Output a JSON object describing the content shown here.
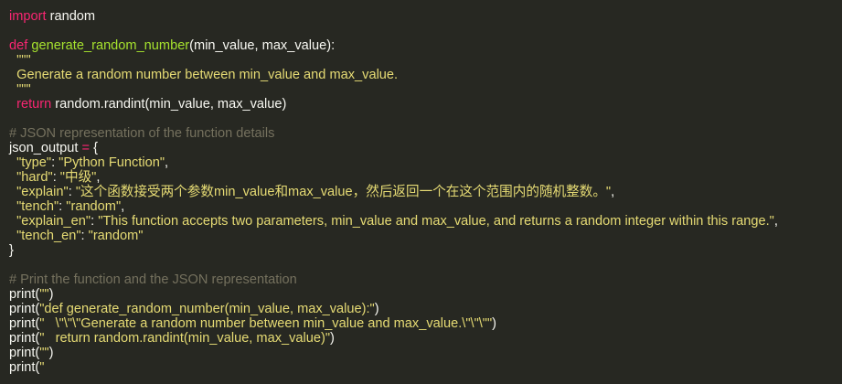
{
  "theme": {
    "background": "#272822",
    "plain": "#f8f8f2",
    "keyword": "#f92672",
    "function": "#a6e22e",
    "string": "#e6db74",
    "comment": "#75715e"
  },
  "code": {
    "l01": {
      "kw": "import",
      "rest": " random"
    },
    "l03": {
      "kw": "def",
      "sp": " ",
      "fn": "generate_random_number",
      "rest": "(min_value, max_value):"
    },
    "l04": {
      "text": "  \"\"\""
    },
    "l05": {
      "text": "  Generate a random number between min_value and max_value."
    },
    "l06": {
      "text": "  \"\"\""
    },
    "l07": {
      "indent": "  ",
      "kw": "return",
      "rest": " random.randint(min_value, max_value)"
    },
    "l09": {
      "text": "# JSON representation of the function details"
    },
    "l10": {
      "a": "json_output ",
      "op": "=",
      "b": " {"
    },
    "l11": {
      "key": "  \"type\"",
      "sep": ": ",
      "val": "\"Python Function\"",
      "end": ","
    },
    "l12": {
      "key": "  \"hard\"",
      "sep": ": ",
      "val": "\"中级\"",
      "end": ","
    },
    "l13": {
      "key": "  \"explain\"",
      "sep": ": ",
      "val": "\"这个函数接受两个参数min_value和max_value，然后返回一个在这个范围内的随机整数。\"",
      "end": ","
    },
    "l14": {
      "key": "  \"tench\"",
      "sep": ": ",
      "val": "\"random\"",
      "end": ","
    },
    "l15": {
      "key": "  \"explain_en\"",
      "sep": ": ",
      "val": "\"This function accepts two parameters, min_value and max_value, and returns a random integer within this range.\"",
      "end": ","
    },
    "l16": {
      "key": "  \"tench_en\"",
      "sep": ": ",
      "val": "\"random\"",
      "end": ""
    },
    "l17": {
      "text": "}"
    },
    "l19": {
      "text": "# Print the function and the JSON representation"
    },
    "l20": {
      "a": "print(",
      "s": "\"\"",
      "b": ")"
    },
    "l21": {
      "a": "print(",
      "s": "\"def generate_random_number(min_value, max_value):\"",
      "b": ")"
    },
    "l22": {
      "a": "print(",
      "s1": "\"   \\\"\\\"\\\"Generate a random number between min_value and max_value.\\\"\\\"\\\"\"",
      "b": ")"
    },
    "l23": {
      "a": "print(",
      "s": "\"   return random.randint(min_value, max_value)\"",
      "b": ")"
    },
    "l24": {
      "a": "print(",
      "s": "\"\"",
      "b": ")"
    },
    "l25": {
      "a": "print(",
      "s": "\"",
      "b": ""
    }
  }
}
